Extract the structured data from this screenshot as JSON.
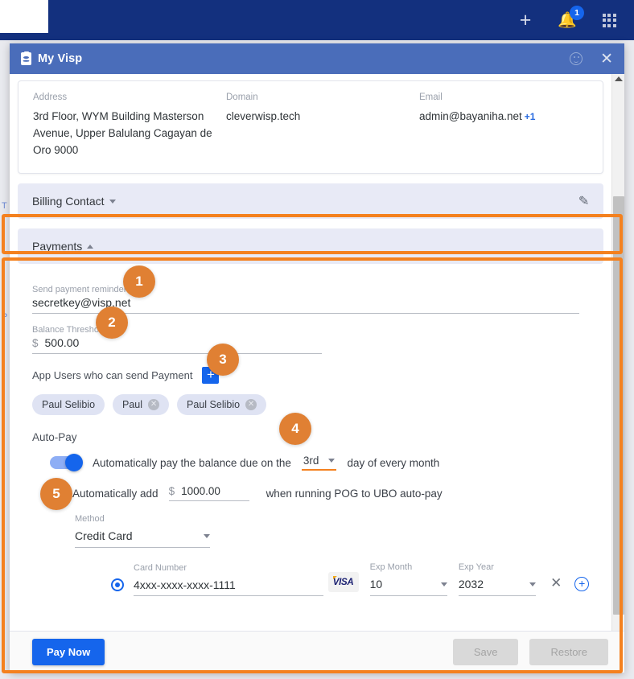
{
  "appbar": {
    "logo_name": "app-logo",
    "add_icon": "plus-icon",
    "notifications_icon": "bell-icon",
    "notifications_count": "1",
    "apps_icon": "grid-apps-icon"
  },
  "background_text": {
    "line1": "T",
    "line2": "P"
  },
  "modal": {
    "title": "My Visp",
    "title_icon": "id-badge-icon",
    "feedback_icon": "smiley-icon",
    "close_icon": "close-icon"
  },
  "account": {
    "address_label": "Address",
    "address_value": "3rd Floor, WYM Building Masterson Avenue, Upper Balulang Cagayan de Oro   9000",
    "domain_label": "Domain",
    "domain_value": "cleverwisp.tech",
    "email_label": "Email",
    "email_value": "admin@bayaniha.net",
    "email_extra": "+1"
  },
  "billing_contact": {
    "title": "Billing Contact",
    "edit_icon": "pencil-icon"
  },
  "payments": {
    "title": "Payments",
    "reminders_label": "Send payment reminders to",
    "reminders_value": "secretkey@visp.net",
    "threshold_label": "Balance Threshold",
    "threshold_currency": "$",
    "threshold_value": "500.00",
    "appusers_label": "App Users who can send Payment",
    "appusers_add_icon": "plus-square-icon",
    "chips": [
      {
        "name": "Paul Selibio",
        "removable": false
      },
      {
        "name": "Paul",
        "removable": true
      },
      {
        "name": "Paul Selibio",
        "removable": true
      }
    ],
    "autopay_title": "Auto-Pay",
    "autopay_toggle_on": true,
    "autopay_text_before": "Automatically pay the balance due on the",
    "autopay_day": "3rd",
    "autopay_text_after": "day of every month",
    "autoadd_checked": true,
    "autoadd_text_before": "Automatically add",
    "autoadd_currency": "$",
    "autoadd_value": "1000.00",
    "autoadd_text_after": "when running POG to UBO auto-pay",
    "method_label": "Method",
    "method_value": "Credit Card",
    "card_number_label": "Card Number",
    "card_number_value": "4xxx-xxxx-xxxx-1111",
    "card_brand": "VISA",
    "exp_month_label": "Exp Month",
    "exp_month_value": "10",
    "exp_year_label": "Exp Year",
    "exp_year_value": "2032",
    "remove_card_icon": "close-icon",
    "add_card_icon": "plus-circle-icon"
  },
  "footer": {
    "pay_now": "Pay Now",
    "save": "Save",
    "restore": "Restore"
  },
  "markers": [
    {
      "n": "1"
    },
    {
      "n": "2"
    },
    {
      "n": "3"
    },
    {
      "n": "4"
    },
    {
      "n": "5"
    }
  ],
  "colors": {
    "appbar": "#13307e",
    "modal_title": "#4a6dba",
    "accent_blue": "#1565ec",
    "highlight_orange": "#f4811f",
    "marker_orange": "#e08033"
  }
}
